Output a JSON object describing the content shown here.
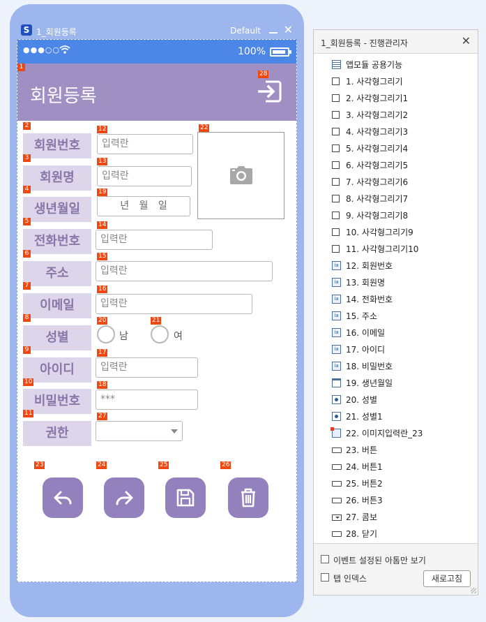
{
  "window": {
    "title": "1_회원등록",
    "profile": "Default"
  },
  "status_bar": {
    "signal": "●●●○○",
    "battery_text": "100%"
  },
  "header": {
    "title": "회원등록"
  },
  "badges": [
    "1",
    "2",
    "3",
    "4",
    "5",
    "6",
    "7",
    "8",
    "9",
    "10",
    "11",
    "12",
    "13",
    "14",
    "15",
    "16",
    "17",
    "18",
    "19",
    "20",
    "21",
    "22",
    "23",
    "24",
    "25",
    "26",
    "27",
    "28"
  ],
  "form": {
    "labels": {
      "member_no": "회원번호",
      "name": "회원명",
      "birth": "생년월일",
      "phone": "전화번호",
      "address": "주소",
      "email": "이메일",
      "gender": "성별",
      "user_id": "아이디",
      "password": "비밀번호",
      "role": "권한"
    },
    "inputs": {
      "member_no": "입력란",
      "name": "입력란",
      "birth": "년  월  일",
      "phone": "입력란",
      "address": "입력란",
      "email": "입력란",
      "user_id": "입력란",
      "password": "***"
    },
    "gender_options": {
      "male": "남",
      "female": "여"
    }
  },
  "panel": {
    "title": "1_회원등록 - 진행관리자",
    "items": [
      {
        "label": "앱모듈 공용기능",
        "icon": "table-icon"
      },
      {
        "label": "1. 사각형그리기",
        "icon": "rectangle-icon"
      },
      {
        "label": "2. 사각형그리기1",
        "icon": "rectangle-icon"
      },
      {
        "label": "3. 사각형그리기2",
        "icon": "rectangle-icon"
      },
      {
        "label": "4. 사각형그리기3",
        "icon": "rectangle-icon"
      },
      {
        "label": "5. 사각형그리기4",
        "icon": "rectangle-icon"
      },
      {
        "label": "6. 사각형그리기5",
        "icon": "rectangle-icon"
      },
      {
        "label": "7. 사각형그리기6",
        "icon": "rectangle-icon"
      },
      {
        "label": "8. 사각형그리기7",
        "icon": "rectangle-icon"
      },
      {
        "label": "9. 사각형그리기8",
        "icon": "rectangle-icon"
      },
      {
        "label": "10. 사각형그리기9",
        "icon": "rectangle-icon"
      },
      {
        "label": "11. 사각형그리기10",
        "icon": "rectangle-icon"
      },
      {
        "label": "12. 회원번호",
        "icon": "textfield-icon"
      },
      {
        "label": "13. 회원명",
        "icon": "textfield-icon"
      },
      {
        "label": "14. 전화번호",
        "icon": "textfield-icon"
      },
      {
        "label": "15. 주소",
        "icon": "textfield-icon"
      },
      {
        "label": "16. 이메일",
        "icon": "textfield-icon"
      },
      {
        "label": "17. 아이디",
        "icon": "textfield-icon"
      },
      {
        "label": "18. 비밀번호",
        "icon": "textfield-icon"
      },
      {
        "label": "19. 생년월일",
        "icon": "calendar-icon"
      },
      {
        "label": "20. 성별",
        "icon": "radio-icon"
      },
      {
        "label": "21. 성별1",
        "icon": "radio-icon"
      },
      {
        "label": "22. 이미지입력란_23",
        "icon": "image-icon"
      },
      {
        "label": "23. 버튼",
        "icon": "button-icon"
      },
      {
        "label": "24. 버튼1",
        "icon": "button-icon"
      },
      {
        "label": "25. 버튼2",
        "icon": "button-icon"
      },
      {
        "label": "26. 버튼3",
        "icon": "button-icon"
      },
      {
        "label": "27. 콤보",
        "icon": "combo-icon"
      },
      {
        "label": "28. 닫기",
        "icon": "button-icon"
      }
    ],
    "footer": {
      "event_only_label": "이벤트 설정된 아톰만 보기",
      "tab_index_label": "탭 인덱스",
      "refresh_label": "새로고침"
    }
  },
  "colors": {
    "phone_frame": "#9db7ee",
    "status_bar": "#4c86e6",
    "header": "#a08fc2",
    "label_bg": "#ddd6ea",
    "label_text": "#8876a8",
    "button": "#9281bd",
    "badge": "#f04810"
  }
}
